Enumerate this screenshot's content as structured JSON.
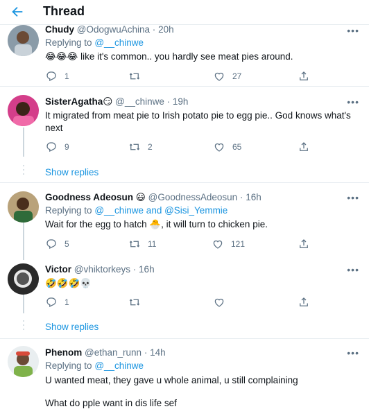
{
  "header": {
    "title": "Thread"
  },
  "tweets": [
    {
      "name": "Chudy",
      "handle": "@OdogwuAchina",
      "dot": "·",
      "time": "20h",
      "replying_label": "Replying to",
      "replying_to": "@__chinwe",
      "text": "😂😂😂 like it's common.. you hardly see meat pies around.",
      "replies": "1",
      "retweets": "",
      "likes": "27"
    },
    {
      "name": "SisterAgatha😏",
      "handle": "@__chinwe",
      "dot": "·",
      "time": "19h",
      "text": "It migrated from meat pie to Irish potato pie to egg pie.. God knows what's next",
      "replies": "9",
      "retweets": "2",
      "likes": "65"
    },
    {
      "name": "Goodness Adeosun 😃",
      "handle": "@GoodnessAdeosun",
      "dot": "·",
      "time": "16h",
      "replying_label": "Replying to",
      "replying_to": "@__chinwe and @Sisi_Yemmie",
      "text": "Wait for the egg to hatch 🐣, it will turn to chicken pie.",
      "replies": "5",
      "retweets": "11",
      "likes": "121"
    },
    {
      "name": "Victor",
      "handle": "@vhiktorkeys",
      "dot": "·",
      "time": "16h",
      "text": "🤣🤣🤣💀",
      "replies": "1",
      "retweets": "",
      "likes": ""
    },
    {
      "name": "Phenom",
      "handle": "@ethan_runn",
      "dot": "·",
      "time": "14h",
      "replying_label": "Replying to",
      "replying_to": "@__chinwe",
      "text": "U wanted meat, they gave u whole animal, u still complaining",
      "text2": "What do pple want in dis life sef"
    }
  ],
  "show_replies": "Show replies",
  "more_glyph": "•••",
  "colors": {
    "accent": "#1b95e0",
    "muted": "#5b7083",
    "border": "#e6ecf0"
  }
}
